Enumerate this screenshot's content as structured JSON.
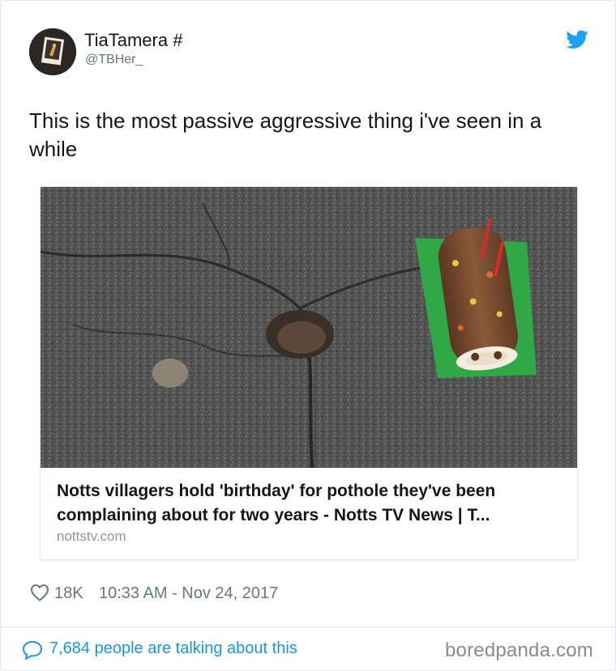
{
  "author": {
    "name": "TiaTamera #",
    "handle": "@TBHer_",
    "avatar": "avatar-photo"
  },
  "brand_icon": "twitter-bird-icon",
  "tweet": {
    "text": "This is the most passive aggressive thing i've seen in a while"
  },
  "link_card": {
    "image": "pothole-with-caterpillar-cake-photo",
    "title": "Notts villagers hold 'birthday' for pothole they've been complaining about for two years - Notts TV News | T...",
    "domain": "nottstv.com"
  },
  "meta": {
    "likes": "18K",
    "timestamp": "10:33 AM - Nov 24, 2017"
  },
  "footer": {
    "talking_text": "7,684 people are talking about this",
    "watermark": "boredpanda.com"
  },
  "colors": {
    "link_blue": "#1b95e0",
    "twitter_blue": "#1da1f2",
    "muted": "#657786",
    "border": "#e1e8ed"
  }
}
